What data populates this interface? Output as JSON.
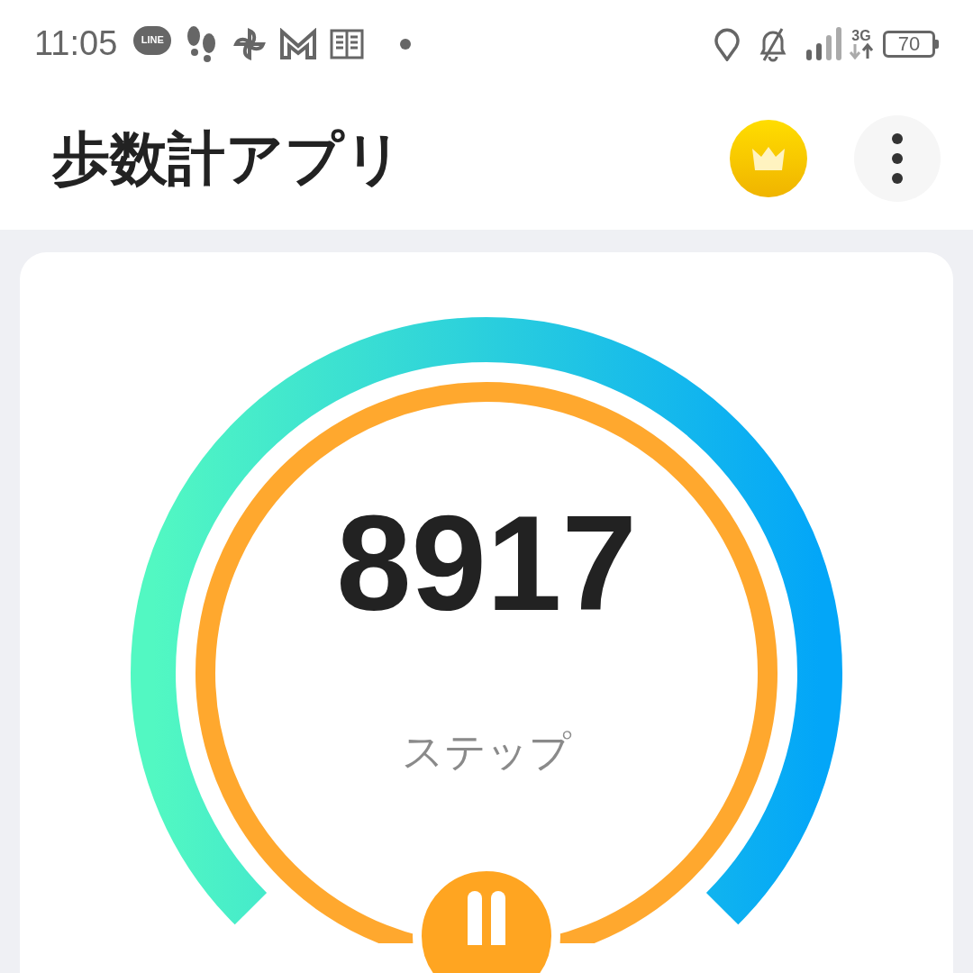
{
  "status_bar": {
    "time": "11:05",
    "line_badge": "LINE",
    "network": "3G",
    "battery": "70"
  },
  "header": {
    "title": "歩数計アプリ"
  },
  "counter": {
    "steps": "8917",
    "unit": "ステップ"
  }
}
